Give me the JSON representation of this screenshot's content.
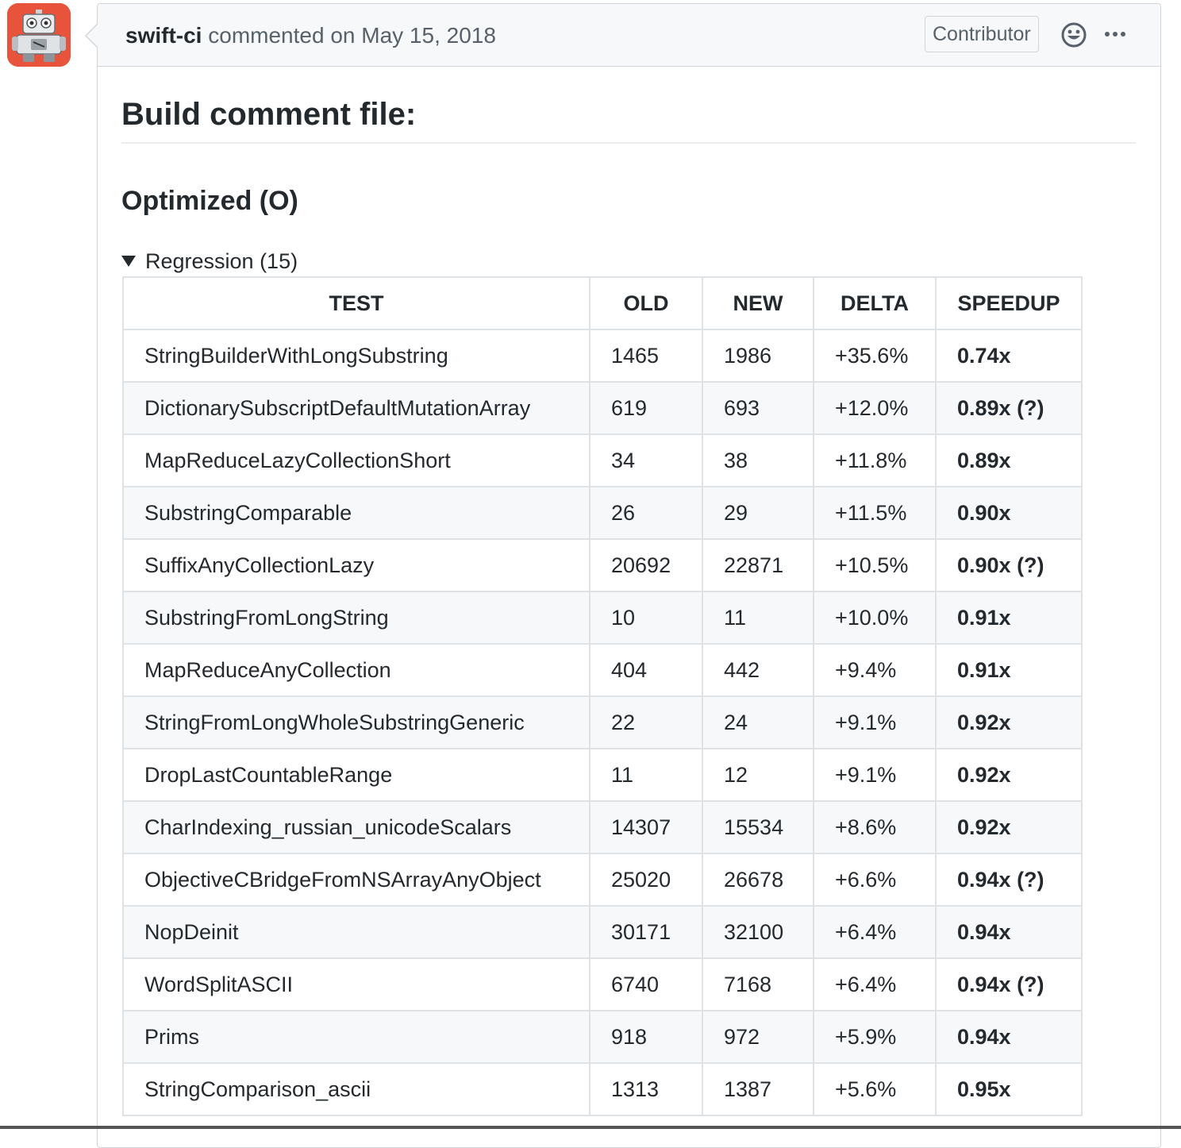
{
  "comment": {
    "author": "swift-ci",
    "action": "commented on May 15, 2018",
    "badge": "Contributor",
    "emoji_icon": "smiley-icon",
    "more_icon": "kebab-horizontal-icon"
  },
  "content": {
    "heading": "Build comment file:",
    "subheading": "Optimized (O)",
    "summary": "Regression (15)"
  },
  "table": {
    "headers": [
      "TEST",
      "OLD",
      "NEW",
      "DELTA",
      "SPEEDUP"
    ],
    "rows": [
      [
        "StringBuilderWithLongSubstring",
        "1465",
        "1986",
        "+35.6%",
        "0.74x"
      ],
      [
        "DictionarySubscriptDefaultMutationArray",
        "619",
        "693",
        "+12.0%",
        "0.89x (?)"
      ],
      [
        "MapReduceLazyCollectionShort",
        "34",
        "38",
        "+11.8%",
        "0.89x"
      ],
      [
        "SubstringComparable",
        "26",
        "29",
        "+11.5%",
        "0.90x"
      ],
      [
        "SuffixAnyCollectionLazy",
        "20692",
        "22871",
        "+10.5%",
        "0.90x (?)"
      ],
      [
        "SubstringFromLongString",
        "10",
        "11",
        "+10.0%",
        "0.91x"
      ],
      [
        "MapReduceAnyCollection",
        "404",
        "442",
        "+9.4%",
        "0.91x"
      ],
      [
        "StringFromLongWholeSubstringGeneric",
        "22",
        "24",
        "+9.1%",
        "0.92x"
      ],
      [
        "DropLastCountableRange",
        "11",
        "12",
        "+9.1%",
        "0.92x"
      ],
      [
        "CharIndexing_russian_unicodeScalars",
        "14307",
        "15534",
        "+8.6%",
        "0.92x"
      ],
      [
        "ObjectiveCBridgeFromNSArrayAnyObject",
        "25020",
        "26678",
        "+6.6%",
        "0.94x (?)"
      ],
      [
        "NopDeinit",
        "30171",
        "32100",
        "+6.4%",
        "0.94x"
      ],
      [
        "WordSplitASCII",
        "6740",
        "7168",
        "+6.4%",
        "0.94x (?)"
      ],
      [
        "Prims",
        "918",
        "972",
        "+5.9%",
        "0.94x"
      ],
      [
        "StringComparison_ascii",
        "1313",
        "1387",
        "+5.6%",
        "0.95x"
      ]
    ]
  }
}
